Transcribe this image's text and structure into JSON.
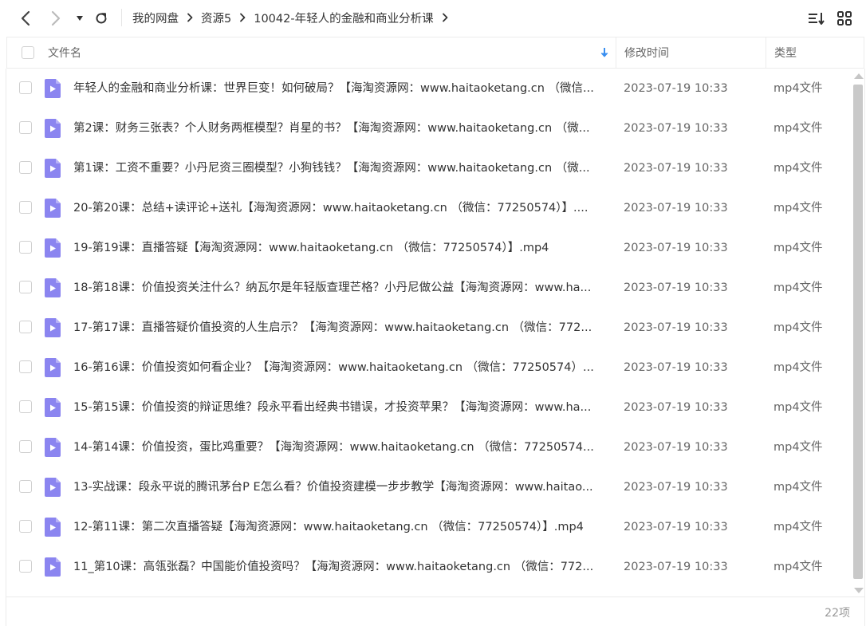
{
  "breadcrumb": [
    {
      "label": "我的网盘"
    },
    {
      "label": "资源5"
    },
    {
      "label": "10042-年轻人的金融和商业分析课"
    }
  ],
  "columns": {
    "name": "文件名",
    "time": "修改时间",
    "type": "类型"
  },
  "files": [
    {
      "name": "年轻人的金融和商业分析课：世界巨变！如何破局？【海淘资源网：www.haitaoketang.cn （微信...",
      "time": "2023-07-19 10:33",
      "type": "mp4文件"
    },
    {
      "name": "第2课：财务三张表？个人财务两框模型？肖星的书？【海淘资源网：www.haitaoketang.cn （微...",
      "time": "2023-07-19 10:33",
      "type": "mp4文件"
    },
    {
      "name": "第1课：工资不重要？小丹尼资三圈模型？小狗钱钱？【海淘资源网：www.haitaoketang.cn （微...",
      "time": "2023-07-19 10:33",
      "type": "mp4文件"
    },
    {
      "name": "20-第20课：总结+读评论+送礼【海淘资源网：www.haitaoketang.cn （微信：77250574）】....",
      "time": "2023-07-19 10:33",
      "type": "mp4文件"
    },
    {
      "name": "19-第19课：直播答疑【海淘资源网：www.haitaoketang.cn （微信：77250574）】.mp4",
      "time": "2023-07-19 10:33",
      "type": "mp4文件"
    },
    {
      "name": "18-第18课：价值投资关注什么？纳瓦尔是年轻版查理芒格？小丹尼做公益【海淘资源网：www.ha...",
      "time": "2023-07-19 10:33",
      "type": "mp4文件"
    },
    {
      "name": "17-第17课：直播答疑价值投资的人生启示？【海淘资源网：www.haitaoketang.cn （微信：772...",
      "time": "2023-07-19 10:33",
      "type": "mp4文件"
    },
    {
      "name": "16-第16课：价值投资如何看企业？【海淘资源网：www.haitaoketang.cn （微信：77250574）...",
      "time": "2023-07-19 10:33",
      "type": "mp4文件"
    },
    {
      "name": "15-第15课：价值投资的辩证思维？段永平看出经典书错误，才投资苹果？【海淘资源网：www.ha...",
      "time": "2023-07-19 10:33",
      "type": "mp4文件"
    },
    {
      "name": "14-第14课：价值投资，蛋比鸡重要？【海淘资源网：www.haitaoketang.cn （微信：77250574...",
      "time": "2023-07-19 10:33",
      "type": "mp4文件"
    },
    {
      "name": "13-实战课：段永平说的腾讯茅台P E怎么看？价值投资建模一步步教学【海淘资源网：www.haitao...",
      "time": "2023-07-19 10:33",
      "type": "mp4文件"
    },
    {
      "name": "12-第11课：第二次直播答疑【海淘资源网：www.haitaoketang.cn （微信：77250574）】.mp4",
      "time": "2023-07-19 10:33",
      "type": "mp4文件"
    },
    {
      "name": "11_第10课：高瓴张磊？中国能价值投资吗？【海淘资源网：www.haitaoketang.cn （微信：772...",
      "time": "2023-07-19 10:33",
      "type": "mp4文件"
    },
    {
      "name": "",
      "time": "",
      "type": ""
    }
  ],
  "footer": {
    "count": "22项"
  },
  "colors": {
    "file_icon": "#8b85f0",
    "sort_arrow": "#3a8ff0",
    "text": "#333333",
    "muted": "#666666"
  },
  "icons": {
    "back": "chevron-left-icon",
    "forward": "chevron-right-icon",
    "history": "caret-down-icon",
    "refresh": "refresh-icon",
    "sort": "sort-list-icon",
    "view": "grid-view-icon",
    "file": "video-file-icon"
  }
}
